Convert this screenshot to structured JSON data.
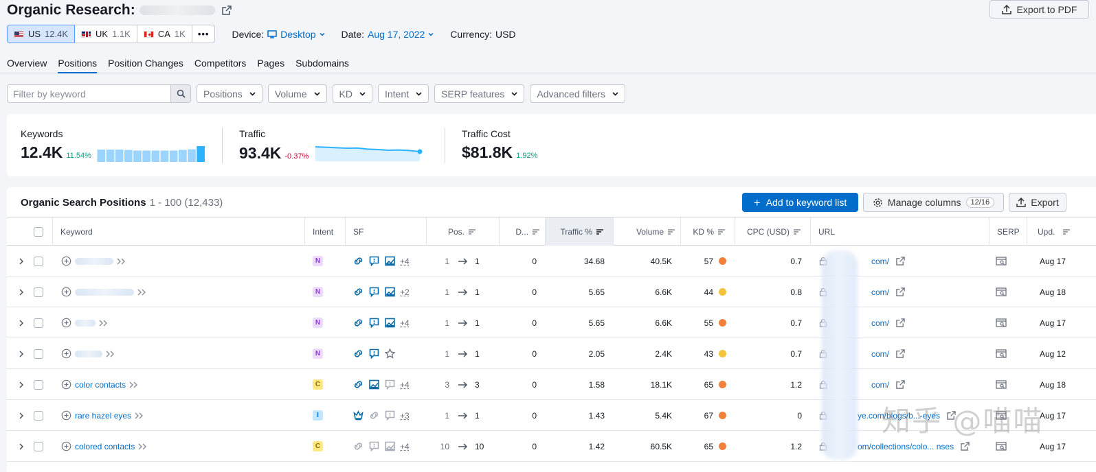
{
  "header": {
    "title": "Organic Research:",
    "export_pdf_label": "Export to PDF"
  },
  "databases": [
    {
      "code": "US",
      "count": "12.4K",
      "flag": "flag-us",
      "active": true
    },
    {
      "code": "UK",
      "count": "1.1K",
      "flag": "flag-uk",
      "active": false
    },
    {
      "code": "CA",
      "count": "1K",
      "flag": "flag-ca",
      "active": false
    }
  ],
  "more_label": "•••",
  "meta": {
    "device_label": "Device:",
    "device_value": "Desktop",
    "date_label": "Date:",
    "date_value": "Aug 17, 2022",
    "currency_label": "Currency:",
    "currency_value": "USD"
  },
  "tabs": [
    "Overview",
    "Positions",
    "Position Changes",
    "Competitors",
    "Pages",
    "Subdomains"
  ],
  "active_tab": "Positions",
  "filters": {
    "search_placeholder": "Filter by keyword",
    "buttons": [
      "Positions",
      "Volume",
      "KD",
      "Intent",
      "SERP features",
      "Advanced filters"
    ]
  },
  "summary": {
    "keywords": {
      "label": "Keywords",
      "value": "12.4K",
      "delta": "11.54%",
      "bars": [
        0.78,
        0.78,
        0.78,
        0.76,
        0.72,
        0.72,
        0.72,
        0.72,
        0.72,
        0.76,
        0.8,
        1.0
      ]
    },
    "traffic": {
      "label": "Traffic",
      "value": "93.4K",
      "delta": "-0.37%",
      "trend": [
        0.95,
        0.92,
        0.88,
        0.85,
        0.86,
        0.78,
        0.75,
        0.7,
        0.72,
        0.68,
        0.6
      ]
    },
    "cost": {
      "label": "Traffic Cost",
      "value": "$81.8K",
      "delta": "1.92%"
    }
  },
  "table": {
    "title": "Organic Search Positions",
    "range": "1 - 100 (12,433)",
    "add_list_label": "Add to keyword list",
    "manage_columns_label": "Manage columns",
    "manage_columns_badge": "12/16",
    "export_label": "Export",
    "columns": {
      "keyword": "Keyword",
      "intent": "Intent",
      "sf": "SF",
      "pos": "Pos.",
      "diff": "D...",
      "traffic": "Traffic %",
      "volume": "Volume",
      "kd": "KD %",
      "cpc": "CPC (USD)",
      "url": "URL",
      "serp": "SERP",
      "upd": "Upd."
    },
    "rows": [
      {
        "keyword": "",
        "blur_w": 56,
        "intent": "N",
        "sf": [
          "link",
          "review",
          "image"
        ],
        "sf_more": "+4",
        "pos_from": "1",
        "pos_to": "1",
        "diff": "0",
        "traffic": "34.68",
        "volume": "40.5K",
        "kd": "57",
        "kd_color": "#f0803c",
        "cpc": "0.7",
        "url": "com/",
        "upd": "Aug 17"
      },
      {
        "keyword": "",
        "blur_w": 86,
        "intent": "N",
        "sf": [
          "link",
          "review",
          "image"
        ],
        "sf_more": "+2",
        "pos_from": "1",
        "pos_to": "1",
        "diff": "0",
        "traffic": "5.65",
        "volume": "6.6K",
        "kd": "44",
        "kd_color": "#f5c33b",
        "cpc": "0.8",
        "url": "com/",
        "upd": "Aug 18"
      },
      {
        "keyword": "",
        "blur_w": 30,
        "intent": "N",
        "sf": [
          "link",
          "review",
          "image"
        ],
        "sf_more": "+4",
        "pos_from": "1",
        "pos_to": "1",
        "diff": "0",
        "traffic": "5.65",
        "volume": "6.6K",
        "kd": "55",
        "kd_color": "#f0803c",
        "cpc": "0.7",
        "url": "com/",
        "upd": "Aug 17"
      },
      {
        "keyword": "",
        "blur_w": 40,
        "intent": "N",
        "sf": [
          "link",
          "review",
          "star"
        ],
        "sf_more": "",
        "pos_from": "1",
        "pos_to": "1",
        "diff": "0",
        "traffic": "2.05",
        "volume": "2.4K",
        "kd": "43",
        "kd_color": "#f5c33b",
        "cpc": "0.7",
        "url": "com/",
        "upd": "Aug 12"
      },
      {
        "keyword": "color contacts",
        "blur_w": 0,
        "intent": "C",
        "sf": [
          "link",
          "image",
          "review-grey"
        ],
        "sf_more": "+4",
        "pos_from": "3",
        "pos_to": "3",
        "diff": "0",
        "traffic": "1.58",
        "volume": "18.1K",
        "kd": "65",
        "kd_color": "#f0803c",
        "cpc": "1.2",
        "url": "com/",
        "upd": "Aug 18"
      },
      {
        "keyword": "rare hazel eyes",
        "blur_w": 0,
        "intent": "I",
        "sf": [
          "crown",
          "link-grey",
          "review-grey"
        ],
        "sf_more": "+3",
        "pos_from": "1",
        "pos_to": "1",
        "diff": "0",
        "traffic": "1.43",
        "volume": "5.4K",
        "kd": "67",
        "kd_color": "#f0803c",
        "cpc": "0",
        "url": "ye.com/blogs/b...-eyes",
        "upd": "Aug 17"
      },
      {
        "keyword": "colored contacts",
        "blur_w": 0,
        "intent": "C",
        "sf": [
          "link-grey",
          "review-grey",
          "image-grey"
        ],
        "sf_more": "+4",
        "pos_from": "10",
        "pos_to": "10",
        "diff": "0",
        "traffic": "1.42",
        "volume": "60.5K",
        "kd": "65",
        "kd_color": "#f0803c",
        "cpc": "1.2",
        "url": "om/collections/colo... nses",
        "upd": "Aug 17"
      }
    ]
  },
  "watermark": "知乎 @喵喵"
}
